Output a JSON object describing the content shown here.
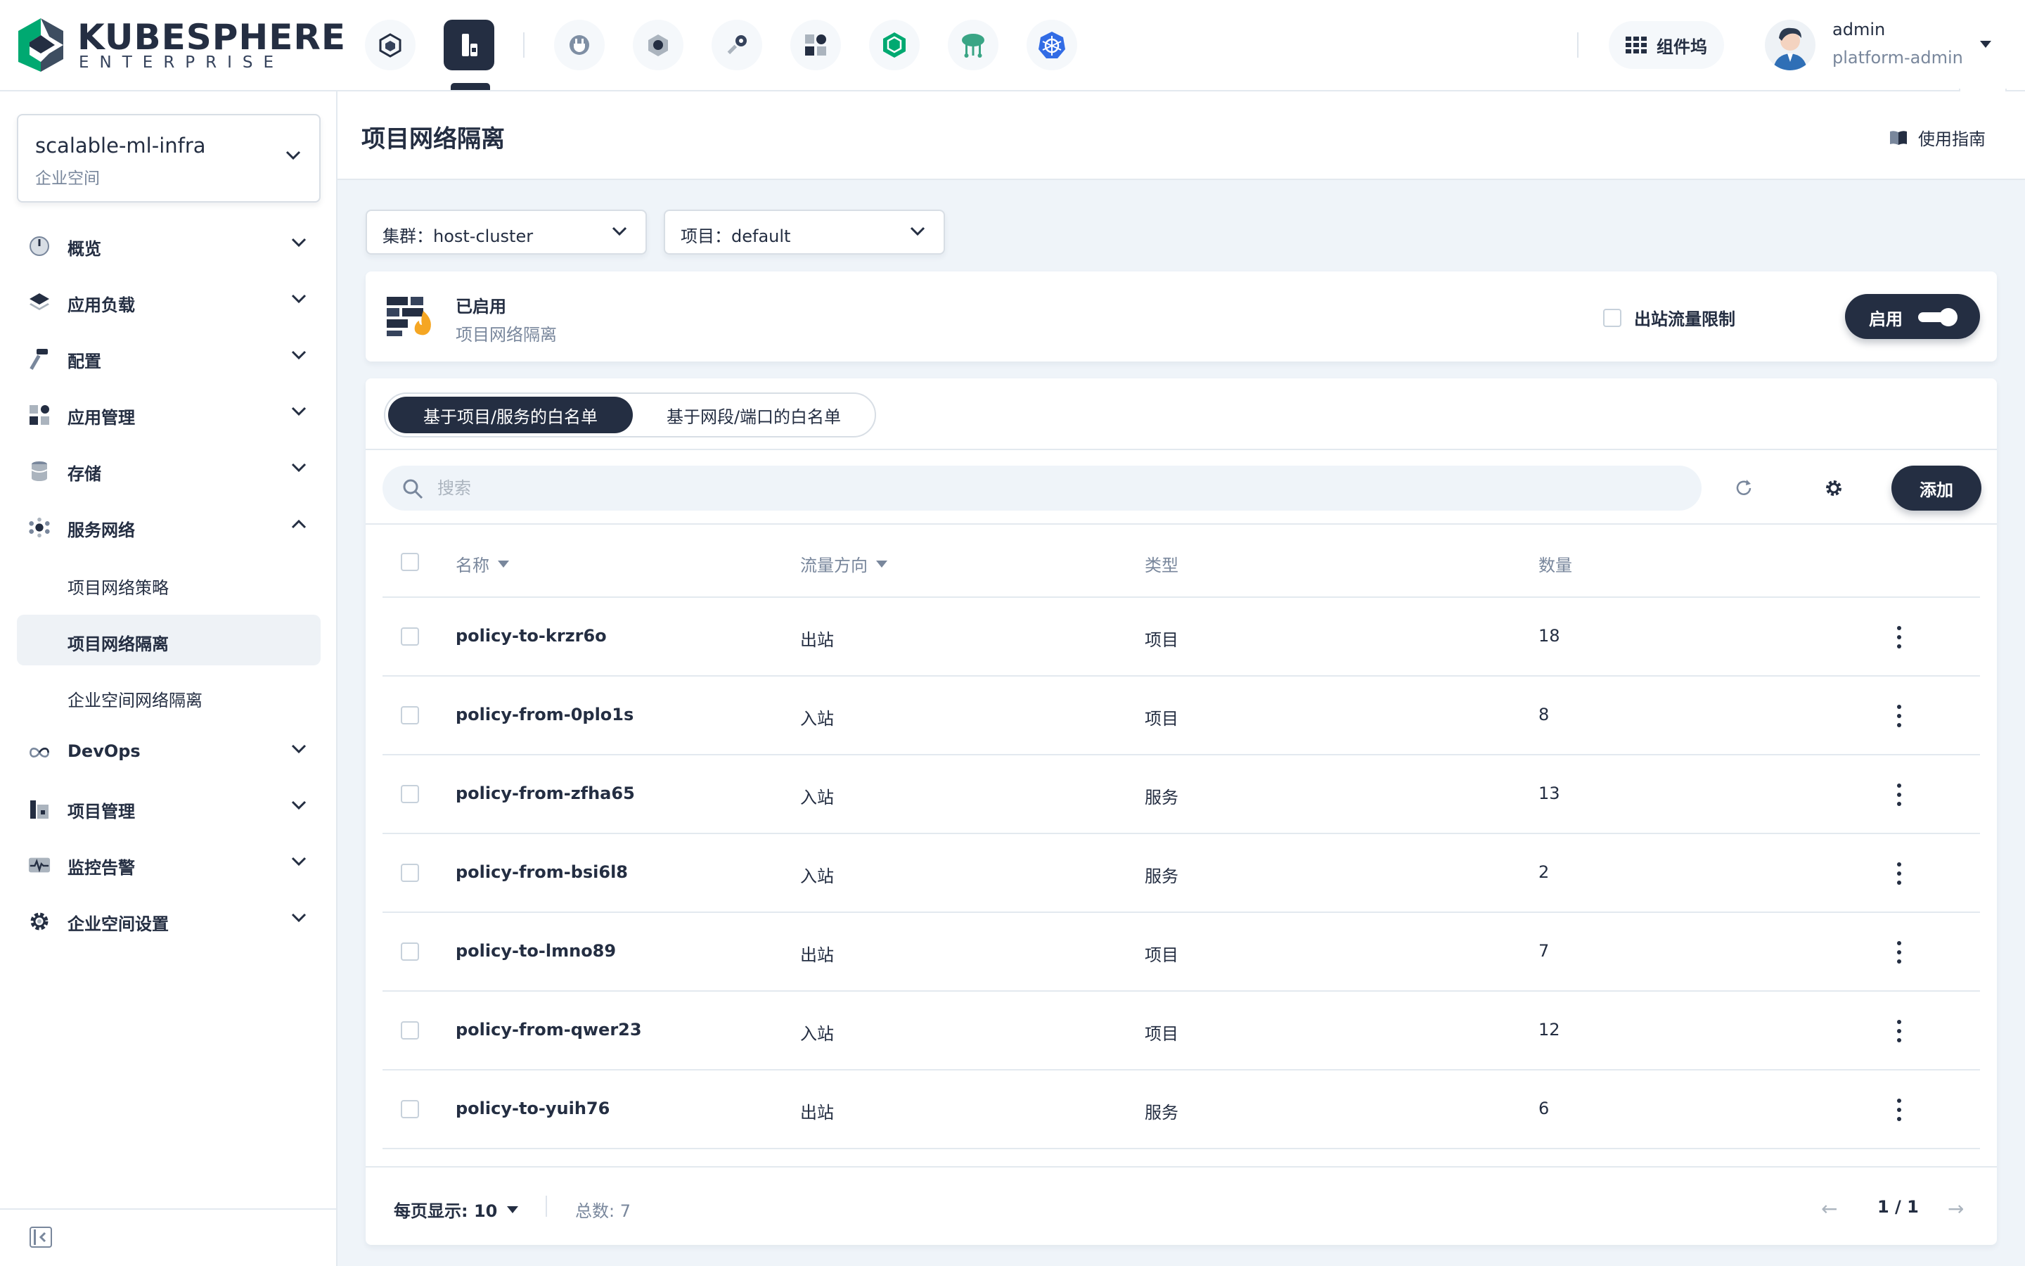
{
  "header": {
    "logo_title": "KUBESPHERE",
    "logo_subtitle": "ENTERPRISE",
    "nav_icons": [
      "cube-icon",
      "project-icon",
      "plug-icon",
      "hexagon-icon",
      "key-icon",
      "apps-grid-icon",
      "box-icon",
      "cloud-tree-icon",
      "kubernetes-icon"
    ],
    "components_label": "组件坞",
    "user_name": "admin",
    "user_role": "platform-admin"
  },
  "sidebar": {
    "workspace_name": "scalable-ml-infra",
    "workspace_type": "企业空间",
    "items": [
      {
        "label": "概览",
        "icon": "gauge-icon"
      },
      {
        "label": "应用负载",
        "icon": "layers-icon"
      },
      {
        "label": "配置",
        "icon": "hammer-icon"
      },
      {
        "label": "应用管理",
        "icon": "apps-icon"
      },
      {
        "label": "存储",
        "icon": "database-icon"
      },
      {
        "label": "服务网络",
        "icon": "network-icon"
      },
      {
        "label": "DevOps",
        "icon": "infinity-icon"
      },
      {
        "label": "项目管理",
        "icon": "project-icon"
      },
      {
        "label": "监控告警",
        "icon": "pulse-icon"
      },
      {
        "label": "企业空间设置",
        "icon": "gear-icon"
      }
    ],
    "sub_items": [
      {
        "label": "项目网络策略"
      },
      {
        "label": "项目网络隔离"
      },
      {
        "label": "企业空间网络隔离"
      }
    ]
  },
  "page": {
    "title": "项目网络隔离",
    "guide_label": "使用指南"
  },
  "filters": {
    "cluster": "集群：host-cluster",
    "project": "项目：default"
  },
  "status": {
    "title": "已启用",
    "desc": "项目网络隔离",
    "egress_label": "出站流量限制",
    "toggle_label": "启用"
  },
  "tabs": [
    {
      "label": "基于项目/服务的白名单"
    },
    {
      "label": "基于网段/端口的白名单"
    }
  ],
  "toolbar": {
    "search_placeholder": "搜索",
    "add_label": "添加"
  },
  "table": {
    "columns": [
      "名称",
      "流量方向",
      "类型",
      "数量"
    ],
    "rows": [
      {
        "name": "policy-to-krzr6o",
        "direction": "出站",
        "type": "项目",
        "count": "18"
      },
      {
        "name": "policy-from-0plo1s",
        "direction": "入站",
        "type": "项目",
        "count": "8"
      },
      {
        "name": "policy-from-zfha65",
        "direction": "入站",
        "type": "服务",
        "count": "13"
      },
      {
        "name": "policy-from-bsi6l8",
        "direction": "入站",
        "type": "服务",
        "count": "2"
      },
      {
        "name": "policy-to-lmno89",
        "direction": "出站",
        "type": "项目",
        "count": "7"
      },
      {
        "name": "policy-from-qwer23",
        "direction": "入站",
        "type": "项目",
        "count": "12"
      },
      {
        "name": "policy-to-yuih76",
        "direction": "出站",
        "type": "服务",
        "count": "6"
      }
    ]
  },
  "pagination": {
    "per_page": "每页显示: 10",
    "total": "总数: 7",
    "page": "1 / 1"
  },
  "colors": {
    "primary": "#242e42",
    "background": "#eff4f9",
    "muted_text": "#79879c",
    "logo_green": "#00a971"
  }
}
